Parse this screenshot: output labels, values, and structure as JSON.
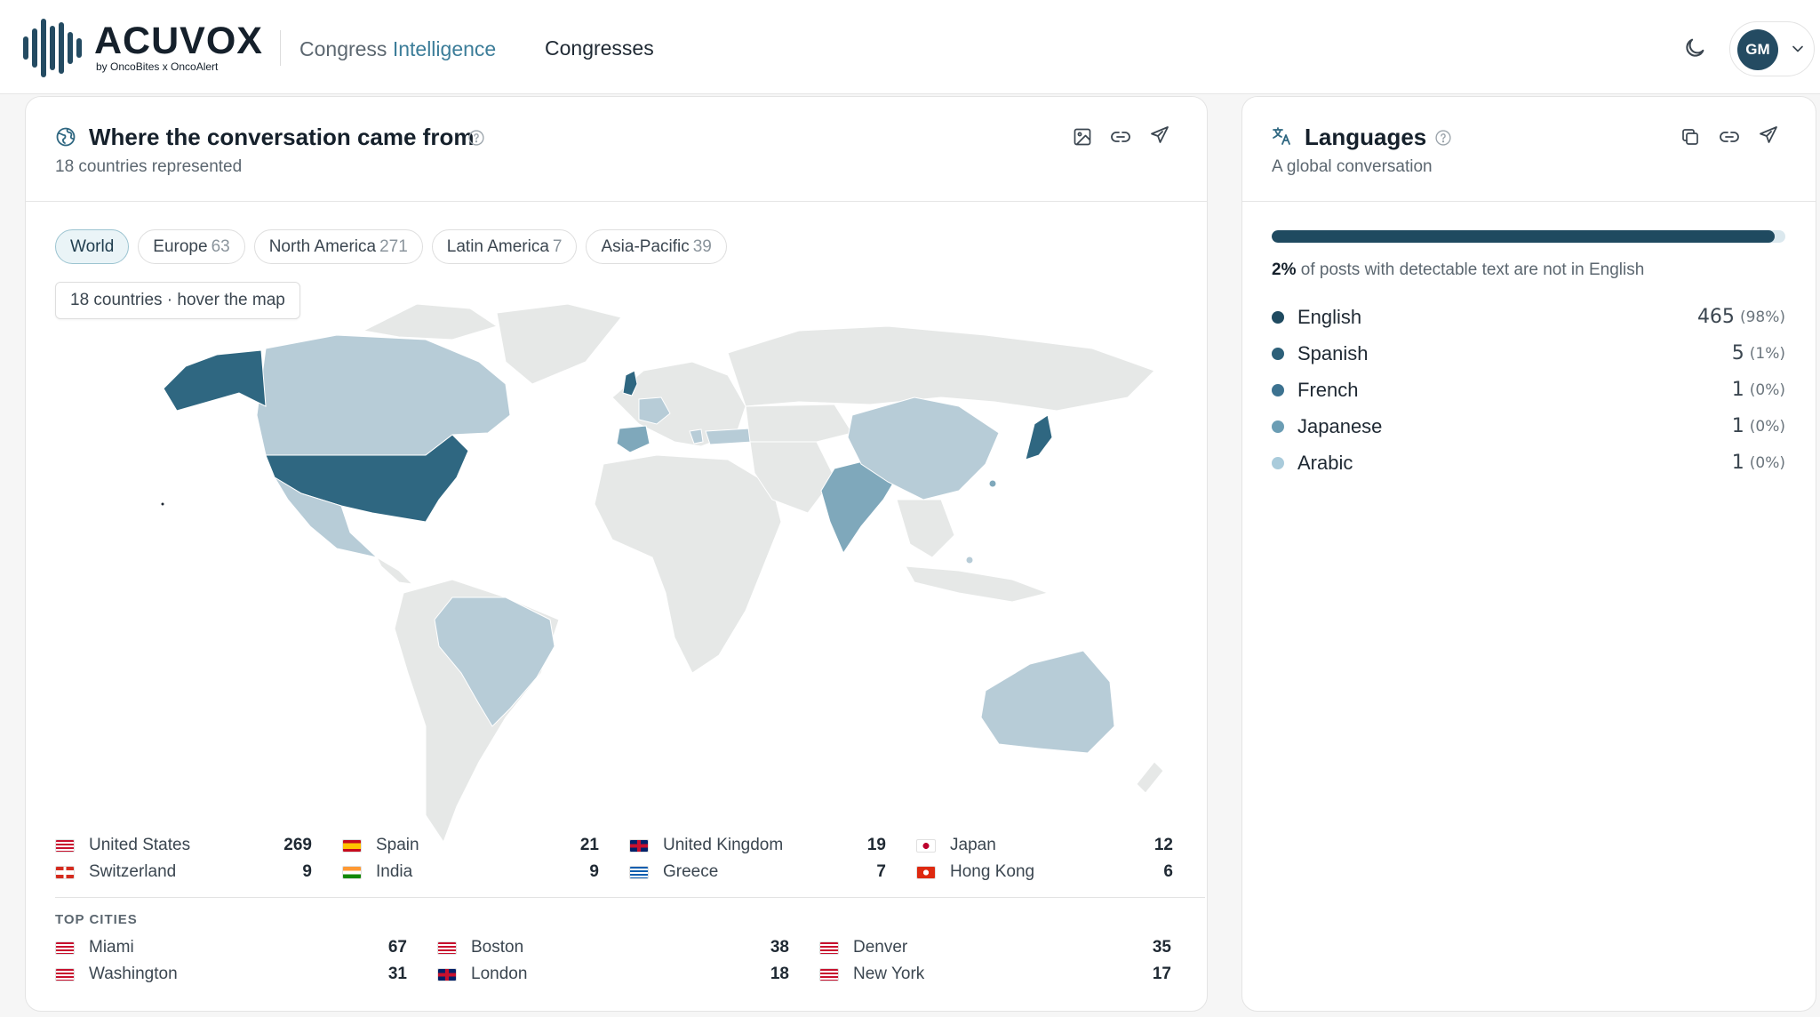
{
  "header": {
    "brand": "ACUVOX",
    "brand_sub": "by OncoBites x OncoAlert",
    "app_name_prefix": "Congress ",
    "app_name_accent": "Intelligence",
    "nav_congresses": "Congresses",
    "user_initials": "GM"
  },
  "geo": {
    "title": "Where the conversation came from",
    "subtitle": "18 countries represented",
    "chips": [
      {
        "label": "World",
        "count": ""
      },
      {
        "label": "Europe",
        "count": "63"
      },
      {
        "label": "North America",
        "count": "271"
      },
      {
        "label": "Latin America",
        "count": "7"
      },
      {
        "label": "Asia-Pacific",
        "count": "39"
      }
    ],
    "hover_hint": "18 countries · hover the map",
    "countries": [
      {
        "name": "United States",
        "count": "269",
        "flag": "us"
      },
      {
        "name": "Spain",
        "count": "21",
        "flag": "es"
      },
      {
        "name": "United Kingdom",
        "count": "19",
        "flag": "gb"
      },
      {
        "name": "Japan",
        "count": "12",
        "flag": "jp"
      },
      {
        "name": "Switzerland",
        "count": "9",
        "flag": "ch"
      },
      {
        "name": "India",
        "count": "9",
        "flag": "in"
      },
      {
        "name": "Greece",
        "count": "7",
        "flag": "gr"
      },
      {
        "name": "Hong Kong",
        "count": "6",
        "flag": "hk"
      }
    ],
    "top_cities_label": "TOP CITIES",
    "cities": [
      {
        "name": "Miami",
        "count": "67",
        "flag": "us"
      },
      {
        "name": "Boston",
        "count": "38",
        "flag": "us"
      },
      {
        "name": "Denver",
        "count": "35",
        "flag": "us"
      },
      {
        "name": "Washington",
        "count": "31",
        "flag": "us"
      },
      {
        "name": "London",
        "count": "18",
        "flag": "gb"
      },
      {
        "name": "New York",
        "count": "17",
        "flag": "us"
      }
    ]
  },
  "languages": {
    "title": "Languages",
    "subtitle": "A global conversation",
    "english_share": 0.98,
    "note_bold": "2%",
    "note_rest": " of posts with detectable text are not in English",
    "items": [
      {
        "name": "English",
        "count": "465",
        "pct": "(98%)",
        "color": "#1f4a60"
      },
      {
        "name": "Spanish",
        "count": "5",
        "pct": "(1%)",
        "color": "#2d6079"
      },
      {
        "name": "French",
        "count": "1",
        "pct": "(0%)",
        "color": "#3c7290"
      },
      {
        "name": "Japanese",
        "count": "1",
        "pct": "(0%)",
        "color": "#6b9db4"
      },
      {
        "name": "Arabic",
        "count": "1",
        "pct": "(0%)",
        "color": "#a9cbdb"
      }
    ]
  },
  "colors": {
    "accent": "#244b62",
    "map_high": "#2f6781",
    "map_mid": "#7fa8bb",
    "map_low": "#b7ccd7",
    "map_none": "#e6e8e7"
  }
}
